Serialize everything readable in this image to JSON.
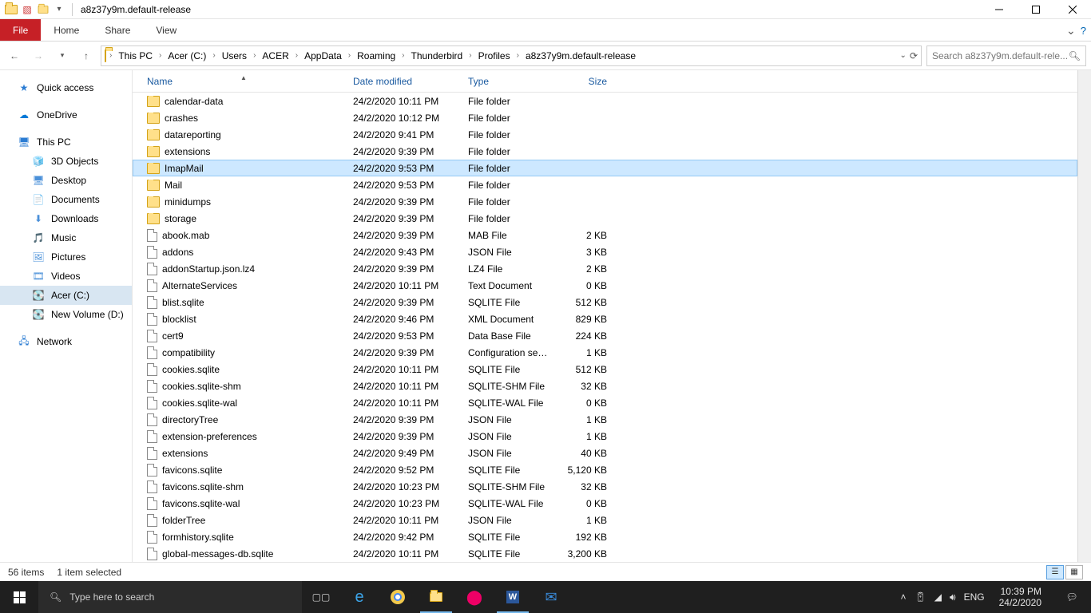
{
  "window": {
    "title": "a8z37y9m.default-release",
    "qat_dropdown": "▾"
  },
  "ribbon": {
    "file": "File",
    "home": "Home",
    "share": "Share",
    "view": "View"
  },
  "breadcrumb": [
    "This PC",
    "Acer (C:)",
    "Users",
    "ACER",
    "AppData",
    "Roaming",
    "Thunderbird",
    "Profiles",
    "a8z37y9m.default-release"
  ],
  "search_placeholder": "Search a8z37y9m.default-rele...",
  "sidebar": {
    "quick_access": "Quick access",
    "onedrive": "OneDrive",
    "this_pc": "This PC",
    "pc_children": [
      "3D Objects",
      "Desktop",
      "Documents",
      "Downloads",
      "Music",
      "Pictures",
      "Videos",
      "Acer (C:)",
      "New Volume (D:)"
    ],
    "network": "Network"
  },
  "columns": {
    "name": "Name",
    "date": "Date modified",
    "type": "Type",
    "size": "Size"
  },
  "selected_index": 4,
  "files": [
    {
      "icon": "folder",
      "name": "calendar-data",
      "date": "24/2/2020 10:11 PM",
      "type": "File folder",
      "size": ""
    },
    {
      "icon": "folder",
      "name": "crashes",
      "date": "24/2/2020 10:12 PM",
      "type": "File folder",
      "size": ""
    },
    {
      "icon": "folder",
      "name": "datareporting",
      "date": "24/2/2020 9:41 PM",
      "type": "File folder",
      "size": ""
    },
    {
      "icon": "folder",
      "name": "extensions",
      "date": "24/2/2020 9:39 PM",
      "type": "File folder",
      "size": ""
    },
    {
      "icon": "folder",
      "name": "ImapMail",
      "date": "24/2/2020 9:53 PM",
      "type": "File folder",
      "size": ""
    },
    {
      "icon": "folder",
      "name": "Mail",
      "date": "24/2/2020 9:53 PM",
      "type": "File folder",
      "size": ""
    },
    {
      "icon": "folder",
      "name": "minidumps",
      "date": "24/2/2020 9:39 PM",
      "type": "File folder",
      "size": ""
    },
    {
      "icon": "folder",
      "name": "storage",
      "date": "24/2/2020 9:39 PM",
      "type": "File folder",
      "size": ""
    },
    {
      "icon": "file",
      "name": "abook.mab",
      "date": "24/2/2020 9:39 PM",
      "type": "MAB File",
      "size": "2 KB"
    },
    {
      "icon": "file",
      "name": "addons",
      "date": "24/2/2020 9:43 PM",
      "type": "JSON File",
      "size": "3 KB"
    },
    {
      "icon": "file",
      "name": "addonStartup.json.lz4",
      "date": "24/2/2020 9:39 PM",
      "type": "LZ4 File",
      "size": "2 KB"
    },
    {
      "icon": "file",
      "name": "AlternateServices",
      "date": "24/2/2020 10:11 PM",
      "type": "Text Document",
      "size": "0 KB"
    },
    {
      "icon": "file",
      "name": "blist.sqlite",
      "date": "24/2/2020 9:39 PM",
      "type": "SQLITE File",
      "size": "512 KB"
    },
    {
      "icon": "file",
      "name": "blocklist",
      "date": "24/2/2020 9:46 PM",
      "type": "XML Document",
      "size": "829 KB"
    },
    {
      "icon": "file",
      "name": "cert9",
      "date": "24/2/2020 9:53 PM",
      "type": "Data Base File",
      "size": "224 KB"
    },
    {
      "icon": "file",
      "name": "compatibility",
      "date": "24/2/2020 9:39 PM",
      "type": "Configuration sett...",
      "size": "1 KB"
    },
    {
      "icon": "file",
      "name": "cookies.sqlite",
      "date": "24/2/2020 10:11 PM",
      "type": "SQLITE File",
      "size": "512 KB"
    },
    {
      "icon": "file",
      "name": "cookies.sqlite-shm",
      "date": "24/2/2020 10:11 PM",
      "type": "SQLITE-SHM File",
      "size": "32 KB"
    },
    {
      "icon": "file",
      "name": "cookies.sqlite-wal",
      "date": "24/2/2020 10:11 PM",
      "type": "SQLITE-WAL File",
      "size": "0 KB"
    },
    {
      "icon": "file",
      "name": "directoryTree",
      "date": "24/2/2020 9:39 PM",
      "type": "JSON File",
      "size": "1 KB"
    },
    {
      "icon": "file",
      "name": "extension-preferences",
      "date": "24/2/2020 9:39 PM",
      "type": "JSON File",
      "size": "1 KB"
    },
    {
      "icon": "file",
      "name": "extensions",
      "date": "24/2/2020 9:49 PM",
      "type": "JSON File",
      "size": "40 KB"
    },
    {
      "icon": "file",
      "name": "favicons.sqlite",
      "date": "24/2/2020 9:52 PM",
      "type": "SQLITE File",
      "size": "5,120 KB"
    },
    {
      "icon": "file",
      "name": "favicons.sqlite-shm",
      "date": "24/2/2020 10:23 PM",
      "type": "SQLITE-SHM File",
      "size": "32 KB"
    },
    {
      "icon": "file",
      "name": "favicons.sqlite-wal",
      "date": "24/2/2020 10:23 PM",
      "type": "SQLITE-WAL File",
      "size": "0 KB"
    },
    {
      "icon": "file",
      "name": "folderTree",
      "date": "24/2/2020 10:11 PM",
      "type": "JSON File",
      "size": "1 KB"
    },
    {
      "icon": "file",
      "name": "formhistory.sqlite",
      "date": "24/2/2020 9:42 PM",
      "type": "SQLITE File",
      "size": "192 KB"
    },
    {
      "icon": "file",
      "name": "global-messages-db.sqlite",
      "date": "24/2/2020 10:11 PM",
      "type": "SQLITE File",
      "size": "3,200 KB"
    }
  ],
  "status": {
    "count": "56 items",
    "selection": "1 item selected"
  },
  "taskbar": {
    "search_placeholder": "Type here to search",
    "lang": "ENG",
    "time": "10:39 PM",
    "date": "24/2/2020"
  }
}
